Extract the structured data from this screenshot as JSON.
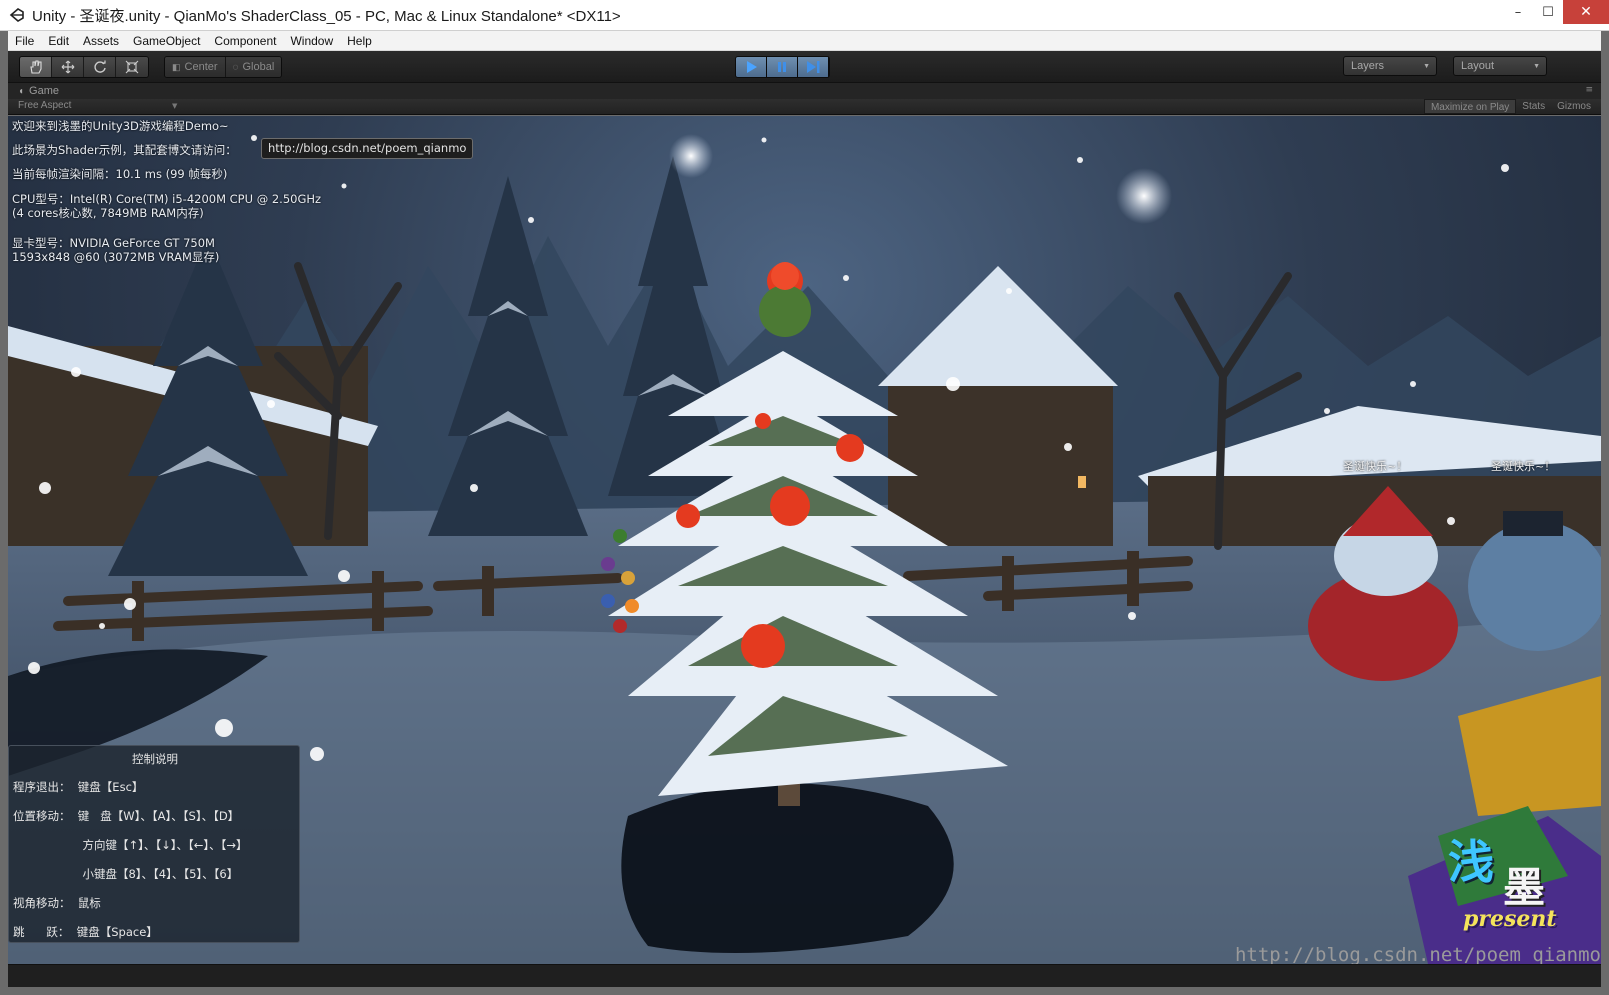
{
  "window": {
    "title": "Unity - 圣诞夜.unity - QianMo's ShaderClass_05 - PC, Mac & Linux Standalone* <DX11>",
    "minimize": "–",
    "maximize": "☐",
    "close": "✕"
  },
  "menu": [
    "File",
    "Edit",
    "Assets",
    "GameObject",
    "Component",
    "Window",
    "Help"
  ],
  "toolbar": {
    "pivot_label": "Center",
    "space_label": "Global",
    "layers_label": "Layers",
    "layout_label": "Layout"
  },
  "game_panel": {
    "tab_label": "Game",
    "aspect_label": "Free Aspect",
    "maximize_label": "Maximize on Play",
    "stats_label": "Stats",
    "gizmos_label": "Gizmos"
  },
  "hud": {
    "welcome": "欢迎来到浅墨的Unity3D游戏编程Demo~",
    "shader_note": "此场景为Shader示例，其配套博文请访问：",
    "url": "http://blog.csdn.net/poem_qianmo",
    "frame_time": "当前每帧渲染间隔：10.1 ms (99 帧每秒)",
    "cpu_line1": "CPU型号：Intel(R) Core(TM) i5-4200M CPU @ 2.50GHz",
    "cpu_line2": "(4 cores核心数, 7849MB RAM内存)",
    "gpu_line1": "显卡型号：NVIDIA GeForce GT 750M",
    "gpu_line2": "1593x848 @60 (3072MB VRAM显存)"
  },
  "controls": {
    "title": "控制说明",
    "rows": [
      "程序退出：  键盘【Esc】",
      "位置移动：  键   盘【W】、【A】、【S】、【D】",
      "                   方向键【↑】、【↓】、【←】、【→】",
      "                   小键盘【8】、【4】、【5】、【6】",
      "视角移动：  鼠标",
      "跳      跃：  键盘【Space】"
    ]
  },
  "npc_labels": [
    "圣诞快乐~！",
    "圣诞快乐~！"
  ],
  "logo": {
    "cn1": "浅",
    "cn2": "墨",
    "present": "present"
  },
  "watermark": "http://blog.csdn.net/poem_qianmo",
  "colors": {
    "play_active": "#5a7ba0",
    "window_close": "#c7413a",
    "panel_bg": "#252525"
  }
}
